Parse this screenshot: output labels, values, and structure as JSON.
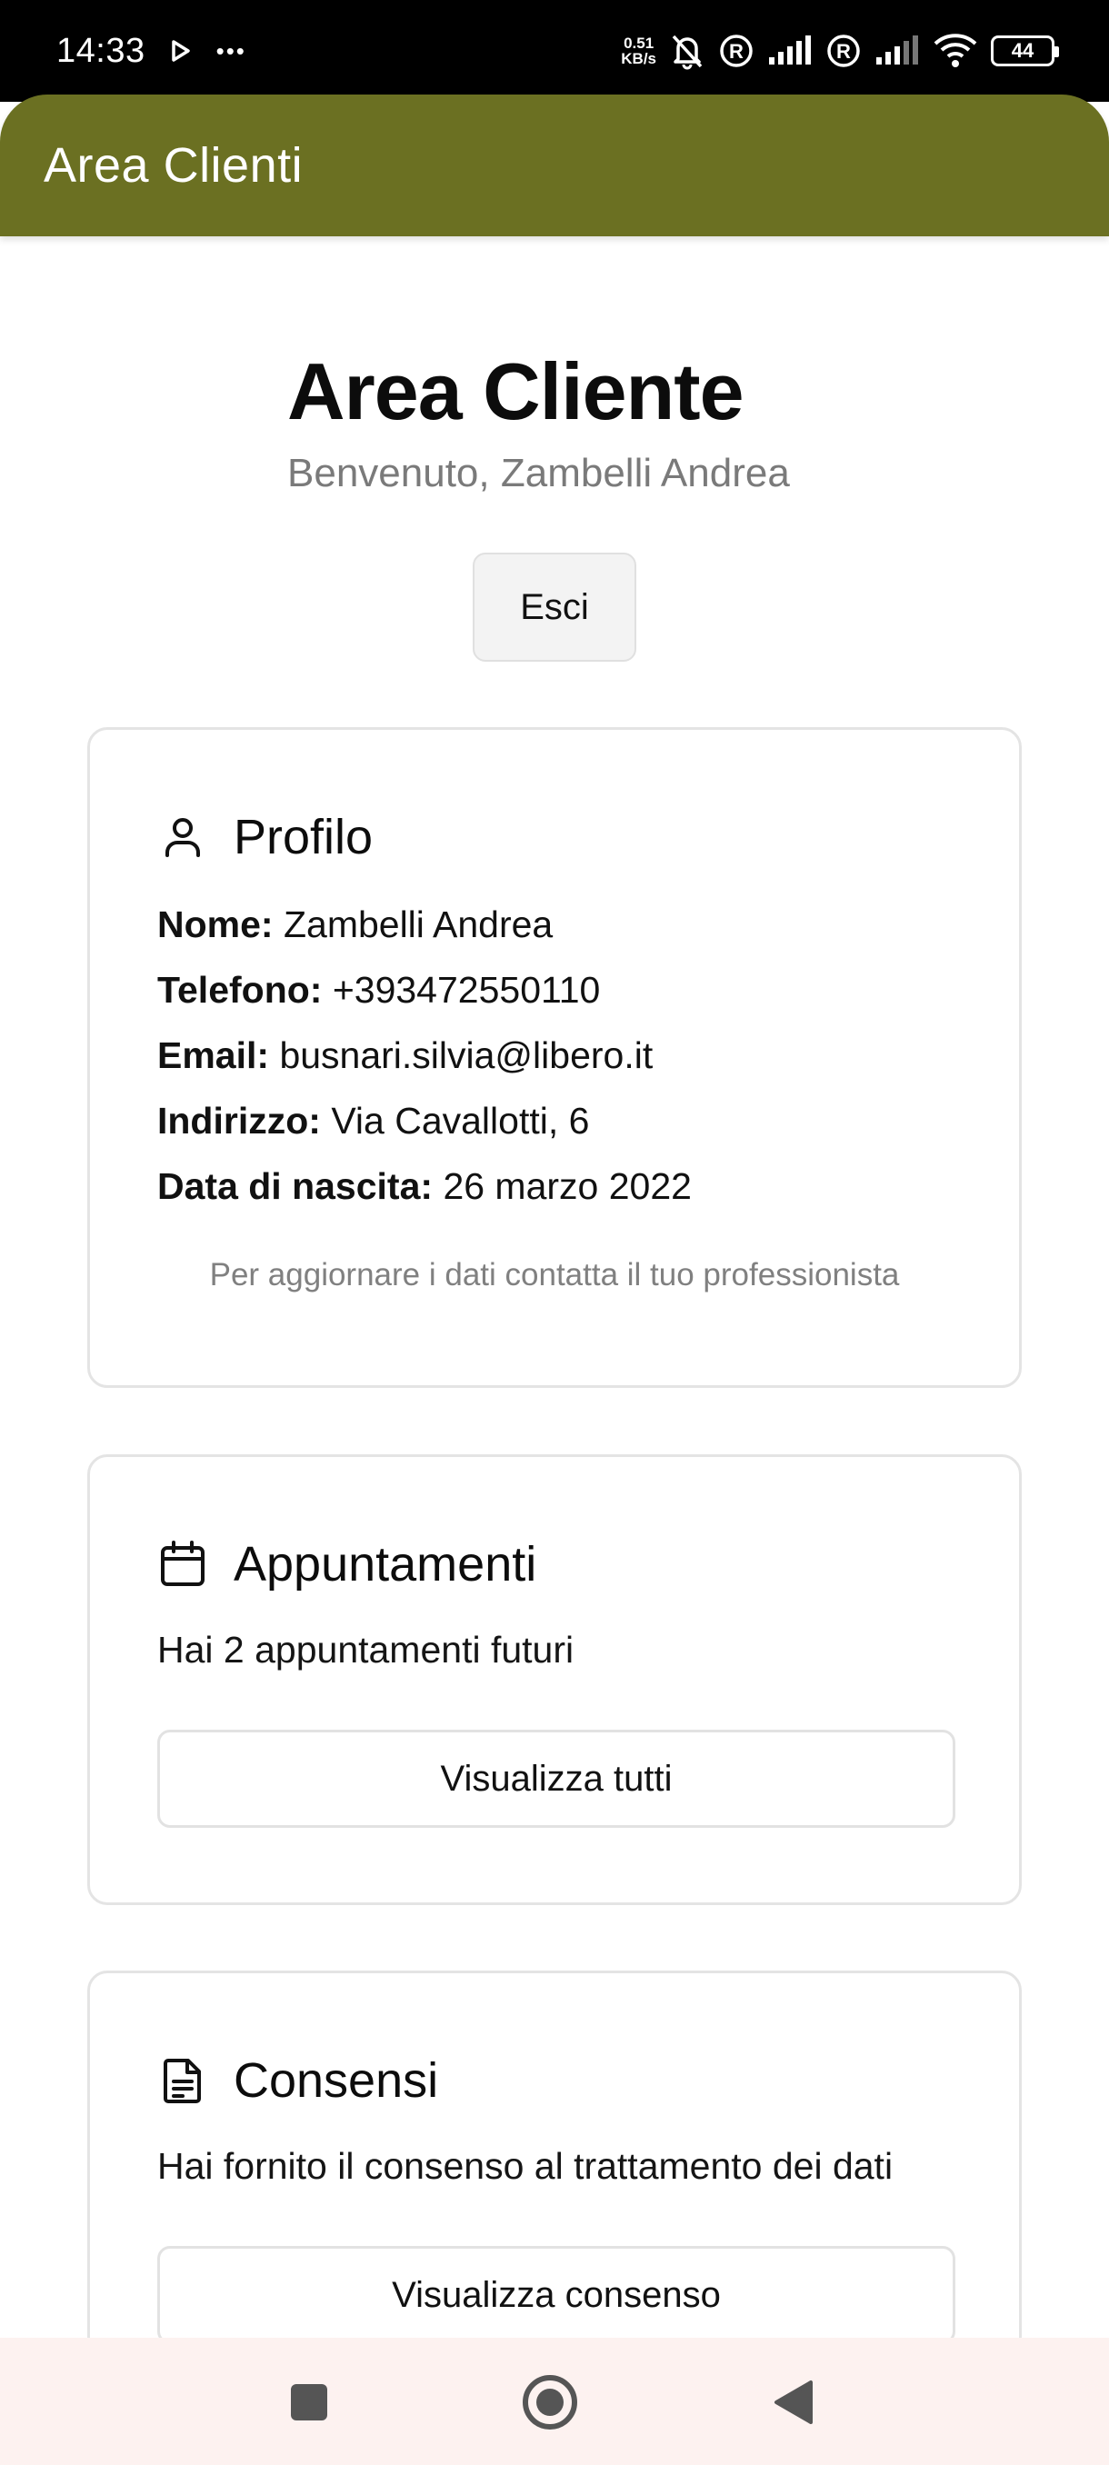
{
  "status_bar": {
    "time": "14:33",
    "more": "•••",
    "speed_value": "0.51",
    "speed_unit": "KB/s",
    "battery": "44"
  },
  "app_bar": {
    "title": "Area Clienti"
  },
  "header": {
    "title": "Area Cliente",
    "subtitle": "Benvenuto, Zambelli Andrea",
    "logout_label": "Esci"
  },
  "profile": {
    "title": "Profilo",
    "icon": "user-icon",
    "fields": [
      {
        "label": "Nome:",
        "value": " Zambelli Andrea"
      },
      {
        "label": "Telefono:",
        "value": " +393472550110"
      },
      {
        "label": "Email:",
        "value": " busnari.silvia@libero.it"
      },
      {
        "label": "Indirizzo:",
        "value": " Via Cavallotti, 6"
      },
      {
        "label": "Data di nascita:",
        "value": " 26 marzo 2022"
      }
    ],
    "note": "Per aggiornare i dati contatta il tuo professionista"
  },
  "appointments": {
    "title": "Appuntamenti",
    "icon": "calendar-icon",
    "text": "Hai 2 appuntamenti futuri",
    "button_label": "Visualizza tutti"
  },
  "consents": {
    "title": "Consensi",
    "icon": "document-icon",
    "text": "Hai fornito il consenso al trattamento dei dati",
    "button_label": "Visualizza consenso"
  },
  "nav": {
    "icons": [
      "recent-apps-icon",
      "home-icon",
      "back-icon"
    ]
  },
  "colors": {
    "app_bar": "#6b7022",
    "nav_bar": "#fdf2f0",
    "card_border": "#e4e4e4"
  }
}
